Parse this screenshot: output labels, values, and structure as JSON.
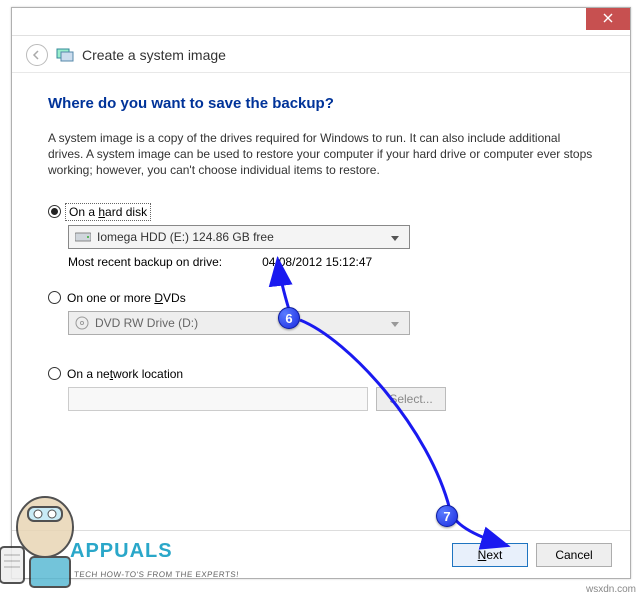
{
  "window": {
    "title": "Create a system image"
  },
  "page": {
    "heading": "Where do you want to save the backup?",
    "description": "A system image is a copy of the drives required for Windows to run. It can also include additional drives. A system image can be used to restore your computer if your hard drive or computer ever stops working; however, you can't choose individual items to restore."
  },
  "options": {
    "hdd": {
      "label_pre": "On a ",
      "label_accel": "h",
      "label_post": "ard disk",
      "selected_drive": "Iomega HDD (E:)  124.86 GB free",
      "meta_label": "Most recent backup on drive:",
      "meta_value": "04/08/2012 15:12:47"
    },
    "dvd": {
      "label_pre": "On one or more ",
      "label_accel": "D",
      "label_post": "VDs",
      "selected_drive": "DVD RW Drive (D:)"
    },
    "net": {
      "label_pre": "On a ne",
      "label_accel": "t",
      "label_post": "work location",
      "select_btn_pre": "",
      "select_btn_accel": "S",
      "select_btn_post": "elect..."
    }
  },
  "footer": {
    "next_accel": "N",
    "next_post": "ext",
    "cancel": "Cancel"
  },
  "annotations": {
    "badge1": "6",
    "badge2": "7"
  },
  "watermark": {
    "logo": "APPUALS",
    "tag": "TECH HOW-TO'S FROM THE EXPERTS!",
    "source": "wsxdn.com"
  }
}
